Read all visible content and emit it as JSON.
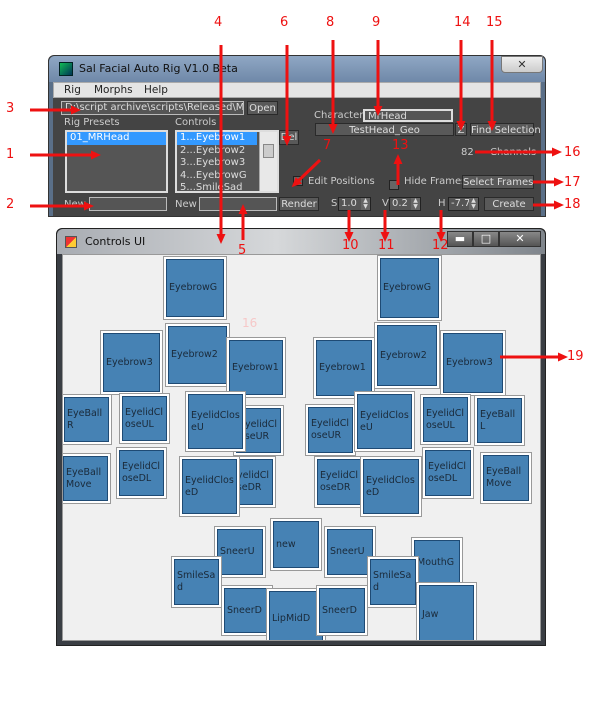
{
  "main_window": {
    "title": "Sal Facial Auto Rig V1.0 Beta",
    "close_glyph": "✕",
    "menu": [
      "Rig",
      "Morphs",
      "Help"
    ],
    "path_value": "D:\\script archive\\scripts\\Released\\Max\\",
    "open_label": "Open",
    "rig_presets_label": "Rig Presets",
    "rig_presets": [
      "01_MRHead"
    ],
    "controls_label": "Controls",
    "controls": [
      "1...Eyebrow1",
      "2...Eyebrow2",
      "3...Eyebrow3",
      "4...EyebrowG",
      "5...SmileSad"
    ],
    "del_label": "Del",
    "new_label": "New",
    "new_preset_value": "",
    "new_control_value": "",
    "render_label": "Render",
    "character_label": "Character",
    "character_value": "MrHead",
    "geo_button": "TestHead_Geo",
    "z_label": "Z",
    "find_selection_label": "Find Selection",
    "channels_count": "82",
    "channels_label": "Channels",
    "edit_positions_label": "Edit Positions",
    "edit_positions_checked": false,
    "hide_frames_label": "Hide Frames",
    "hide_frames_checked": false,
    "select_frames_label": "Select Frames",
    "s_label": "S",
    "s_value": "1.0",
    "v_label": "V",
    "v_value": "0.2",
    "h_label": "H",
    "h_value": "-7.7",
    "create_label": "Create"
  },
  "controls_window": {
    "title": "Controls UI",
    "minimize_glyph": "▬",
    "maximize_glyph": "□",
    "close_glyph": "✕",
    "faint_number": "16",
    "buttons": [
      "EyebrowG",
      "Eyebrow3",
      "Eyebrow2",
      "Eyebrow1",
      "EyeBall R",
      "EyelidCloseUL",
      "EyelidCloseUR",
      "EyelidCloseU",
      "EyebrowG",
      "Eyebrow1",
      "Eyebrow2",
      "Eyebrow3",
      "EyelidCloseUR",
      "EyelidCloseU",
      "EyelidCloseUL",
      "EyeBallL",
      "EyeBall Move",
      "EyelidCloseDL",
      "EyelidCloseDR",
      "EyelidCloseD",
      "EyelidCloseDR",
      "EyelidCloseD",
      "EyelidCloseDL",
      "EyeBall Move",
      "SneerU",
      "new",
      "SmileSad",
      "SneerD",
      "LipMidD",
      "SneerU",
      "SneerD",
      "MouthG",
      "SmileSad",
      "Jaw"
    ]
  },
  "annotations": [
    "1",
    "2",
    "3",
    "4",
    "5",
    "6",
    "7",
    "8",
    "9",
    "10",
    "11",
    "12",
    "13",
    "14",
    "15",
    "16",
    "17",
    "18",
    "19"
  ],
  "colors": {
    "annotation": "#ee1111",
    "control_button": "#4682b4",
    "selection": "#3399ff"
  }
}
